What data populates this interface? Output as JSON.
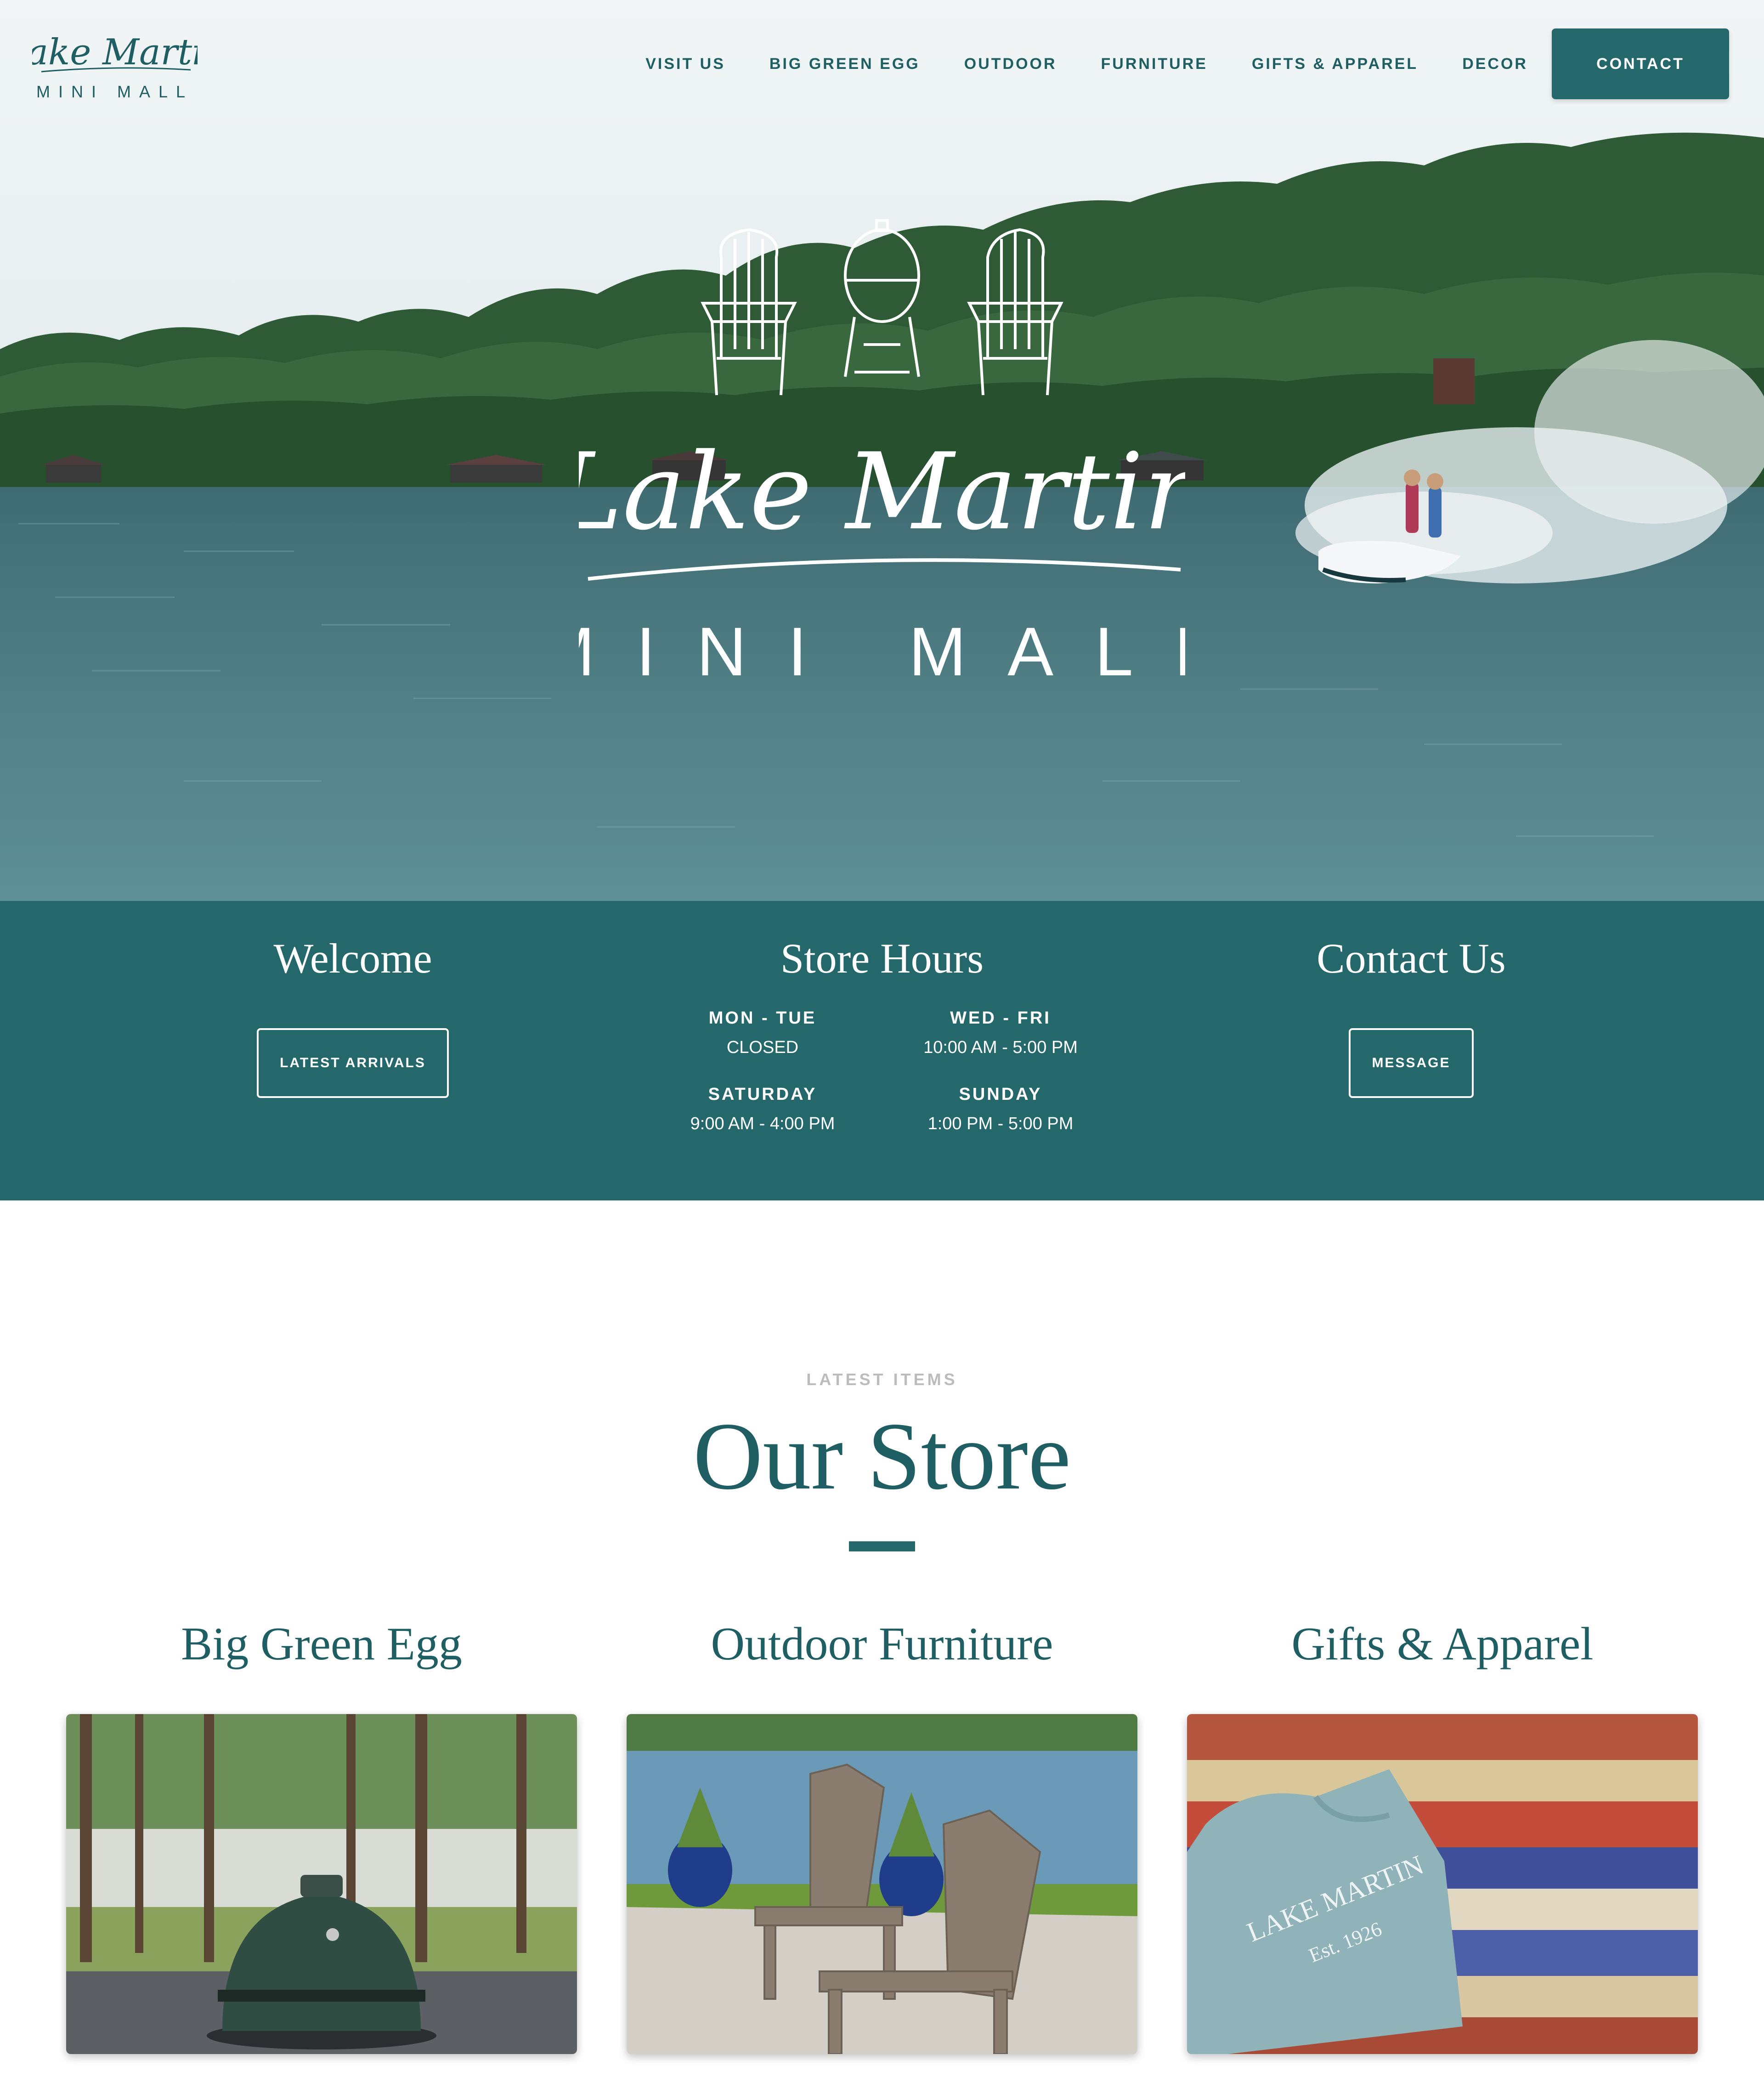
{
  "header": {
    "logo": {
      "line1": "Lake Martin",
      "line2": "MINI MALL"
    },
    "nav": [
      {
        "label": "VISIT US"
      },
      {
        "label": "BIG GREEN EGG"
      },
      {
        "label": "OUTDOOR"
      },
      {
        "label": "FURNITURE"
      },
      {
        "label": "GIFTS & APPAREL"
      },
      {
        "label": "DECOR"
      }
    ],
    "contact_label": "CONTACT"
  },
  "hero": {
    "logo_line1": "Lake Martin",
    "logo_line2": "MINI MALL"
  },
  "info": {
    "welcome": {
      "title": "Welcome",
      "button": "LATEST ARRIVALS"
    },
    "hours": {
      "title": "Store Hours",
      "rows": [
        {
          "day": "MON - TUE",
          "time": "CLOSED"
        },
        {
          "day": "WED - FRI",
          "time": "10:00 AM - 5:00 PM"
        },
        {
          "day": "SATURDAY",
          "time": "9:00 AM - 4:00 PM"
        },
        {
          "day": "SUNDAY",
          "time": "1:00 PM - 5:00 PM"
        }
      ]
    },
    "contact": {
      "title": "Contact Us",
      "button": "MESSAGE"
    }
  },
  "store": {
    "eyebrow": "LATEST ITEMS",
    "title": "Our Store",
    "cards": [
      {
        "title": "Big Green Egg"
      },
      {
        "title": "Outdoor Furniture"
      },
      {
        "title": "Gifts & Apparel",
        "shirt_text_1": "LAKE MARTIN",
        "shirt_text_2": "Est. 1926"
      }
    ]
  },
  "colors": {
    "teal": "#25686b",
    "teal_dark": "#1f5e62",
    "eyebrow_gray": "#bcbcbc",
    "white": "#ffffff"
  }
}
